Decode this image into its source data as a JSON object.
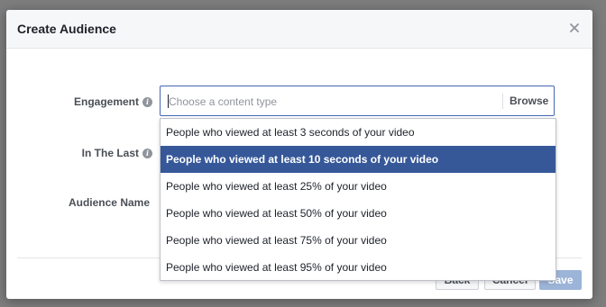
{
  "modal": {
    "title": "Create Audience",
    "close_icon": "close-icon"
  },
  "form": {
    "engagement_label": "Engagement",
    "in_the_last_label": "In The Last",
    "audience_name_label": "Audience Name",
    "info_icon": "info-icon",
    "content_type_placeholder": "Choose a content type",
    "browse_label": "Browse"
  },
  "dropdown": {
    "selected_index": 1,
    "options": [
      "People who viewed at least 3 seconds of your video",
      "People who viewed at least 10 seconds of your video",
      "People who viewed at least 25% of your video",
      "People who viewed at least 50% of your video",
      "People who viewed at least 75% of your video",
      "People who viewed at least 95% of your video"
    ]
  },
  "footer": {
    "back_label": "Back",
    "cancel_label": "Cancel",
    "save_label": "Save"
  },
  "colors": {
    "accent": "#4267b2",
    "selected_bg": "#365899",
    "save_disabled": "#9cb4d8"
  }
}
